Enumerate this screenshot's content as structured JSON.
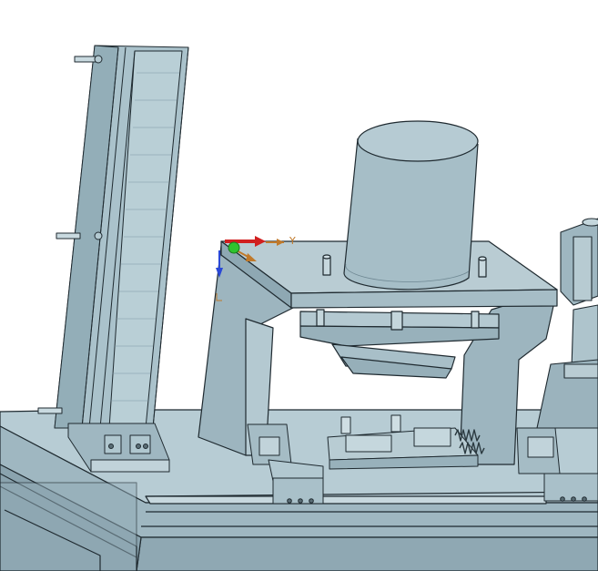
{
  "viewport": {
    "background_color": "#ffffff",
    "model_color": "#a9c2cb",
    "edge_color": "#1f2a30"
  },
  "triad": {
    "x_axis_color": "#d11f1f",
    "y_axis_color": "#c0792a",
    "z_axis_color": "#2a48d6",
    "origin_color": "#2ec42e",
    "y_label": "Y"
  },
  "model": {
    "components": [
      "rail-column",
      "cylinder",
      "press-frame",
      "base-table",
      "fixture-plate",
      "side-actuator"
    ]
  }
}
